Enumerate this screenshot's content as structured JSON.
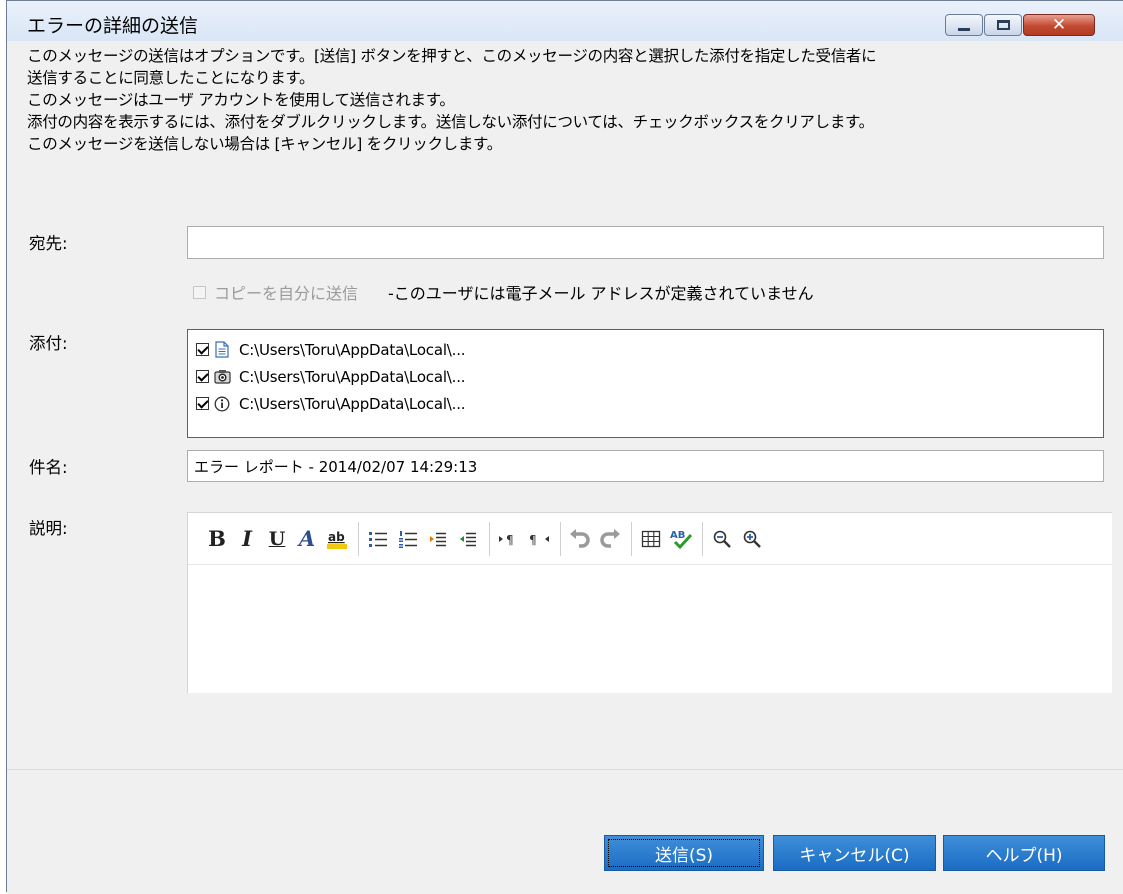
{
  "window": {
    "title": "エラーの詳細の送信",
    "close_glyph": "✕"
  },
  "info_lines": [
    "このメッセージの送信はオプションです。[送信] ボタンを押すと、このメッセージの内容と選択した添付を指定した受信者に",
    "送信することに同意したことになります。",
    "このメッセージはユーザ アカウントを使用して送信されます。",
    "添付の内容を表示するには、添付をダブルクリックします。送信しない添付については、チェックボックスをクリアします。",
    "このメッセージを送信しない場合は [キャンセル] をクリックします。"
  ],
  "to": {
    "label": "宛先:",
    "value": "",
    "copy_label": "コピーを自分に送信",
    "copy_checked": false,
    "copy_note": "-このユーザには電子メール アドレスが定義されていません"
  },
  "attachments": {
    "label": "添付:",
    "items": [
      {
        "path": "C:\\Users\\Toru\\AppData\\Local\\...",
        "icon": "document-icon",
        "checked": true
      },
      {
        "path": "C:\\Users\\Toru\\AppData\\Local\\...",
        "icon": "camera-icon",
        "checked": true
      },
      {
        "path": "C:\\Users\\Toru\\AppData\\Local\\...",
        "icon": "info-icon",
        "checked": true
      }
    ]
  },
  "subject": {
    "label": "件名:",
    "value": "エラー レポート - 2014/02/07 14:29:13"
  },
  "description": {
    "label": "説明:",
    "toolbar": {
      "bold": "B",
      "italic": "I",
      "underline": "U",
      "font": "A",
      "highlight": "ab"
    }
  },
  "buttons": {
    "send": "送信(S)",
    "cancel": "キャンセル(C)",
    "help": "ヘルプ(H)"
  }
}
